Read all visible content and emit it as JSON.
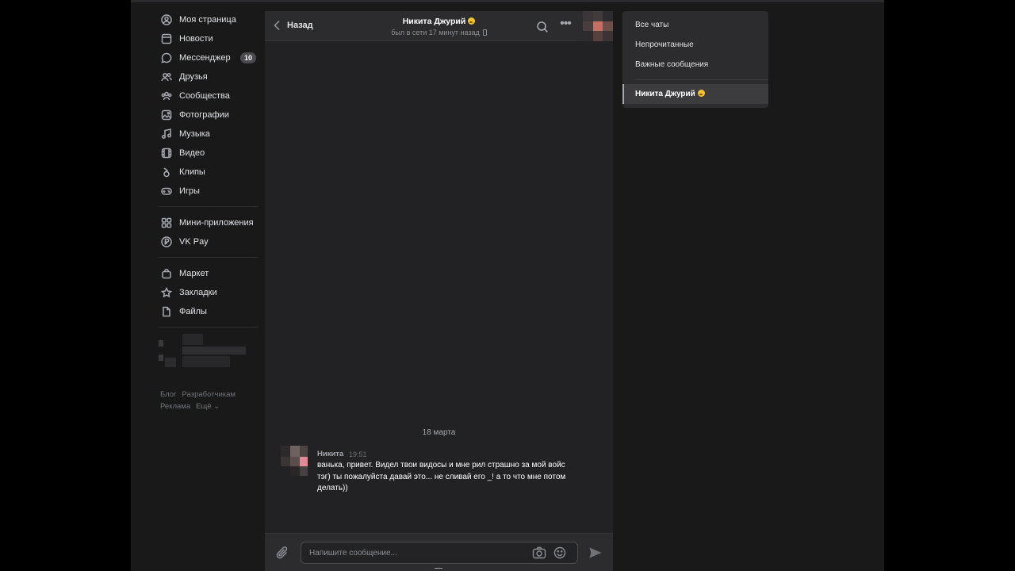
{
  "nav": {
    "items": [
      {
        "label": "Моя страница",
        "icon": "user-circle-icon"
      },
      {
        "label": "Новости",
        "icon": "news-icon"
      },
      {
        "label": "Мессенджер",
        "icon": "message-icon",
        "badge": "10"
      },
      {
        "label": "Друзья",
        "icon": "friends-icon"
      },
      {
        "label": "Сообщества",
        "icon": "communities-icon"
      },
      {
        "label": "Фотографии",
        "icon": "photo-icon"
      },
      {
        "label": "Музыка",
        "icon": "music-icon"
      },
      {
        "label": "Видео",
        "icon": "video-icon"
      },
      {
        "label": "Клипы",
        "icon": "clips-icon"
      },
      {
        "label": "Игры",
        "icon": "gamepad-icon"
      }
    ],
    "apps": [
      {
        "label": "Мини-приложения",
        "icon": "apps-icon"
      },
      {
        "label": "VK Pay",
        "icon": "vkpay-icon"
      }
    ],
    "extra": [
      {
        "label": "Маркет",
        "icon": "bag-icon"
      },
      {
        "label": "Закладки",
        "icon": "star-icon"
      },
      {
        "label": "Файлы",
        "icon": "file-icon"
      }
    ]
  },
  "footer": {
    "blog": "Блог",
    "developers": "Разработчикам",
    "ads": "Реклама",
    "more": "Ещё ⌄"
  },
  "chat": {
    "back_label": "Назад",
    "peer_name": "Никита Джурий",
    "peer_status": "был в сети 17 минут назад",
    "date_label": "18 марта",
    "message": {
      "author": "Никита",
      "time": "19:51",
      "text": "ванька, привет. Видел твои видосы и мне рил страшно за мой войс тэг) ты пожалуйста давай это... не сливай его _! а то что мне потом делать))"
    },
    "composer_placeholder": "Напишите сообщение..."
  },
  "filters": {
    "all": "Все чаты",
    "unread": "Непрочитанные",
    "important": "Важные сообщения",
    "active_chat": "Никита Джурий"
  },
  "colors": {
    "background": "#19191a",
    "panel": "#222224",
    "header": "#2c2c2e",
    "text": "#e1e3e6",
    "muted": "#8b8f95"
  }
}
